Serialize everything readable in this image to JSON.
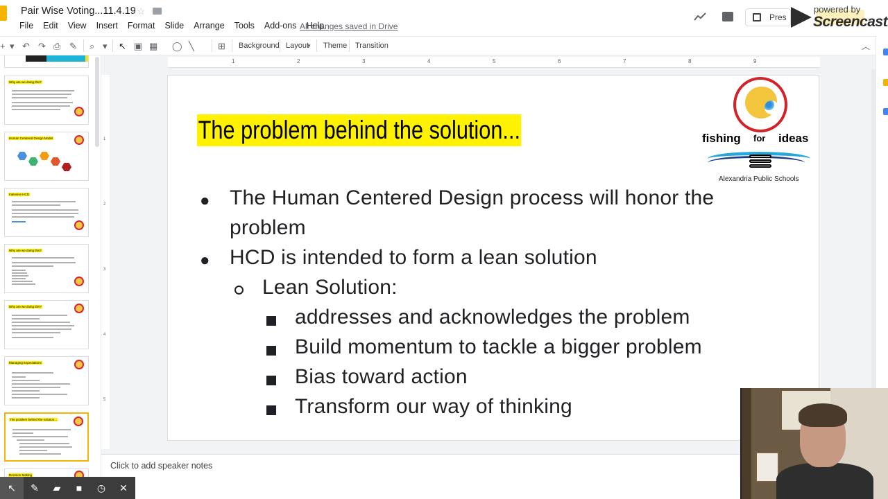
{
  "document": {
    "title": "Pair Wise Voting...11.4.19",
    "save_status": "All changes saved in Drive"
  },
  "menu": [
    "File",
    "Edit",
    "View",
    "Insert",
    "Format",
    "Slide",
    "Arrange",
    "Tools",
    "Add-ons",
    "Help"
  ],
  "header": {
    "present_label": "Pres",
    "screencast_powered": "powered by",
    "screencast_brand": "Screencastify"
  },
  "toolbar": {
    "background_label": "Background",
    "layout_label": "Layout",
    "theme_label": "Theme",
    "transition_label": "Transition"
  },
  "ruler": {
    "top_ticks": [
      "1",
      "2",
      "3",
      "4",
      "5",
      "6",
      "7",
      "8",
      "9"
    ],
    "left_ticks": [
      "1",
      "2",
      "3",
      "4",
      "5"
    ]
  },
  "filmstrip": {
    "thumbnails": [
      {
        "title": "",
        "kind": "image"
      },
      {
        "title": "Why are we doing this?",
        "kind": "text"
      },
      {
        "title": "Human Centered Design Model",
        "kind": "hexes"
      },
      {
        "title": "Intensive HCD",
        "kind": "text"
      },
      {
        "title": "Why are we doing this?",
        "kind": "text"
      },
      {
        "title": "Why are we doing this?",
        "kind": "text"
      },
      {
        "title": "Managing Expectations",
        "kind": "text"
      },
      {
        "title": "The problem behind the solution...",
        "kind": "text",
        "selected": true
      },
      {
        "title": "Decision Making",
        "kind": "text"
      }
    ]
  },
  "slide": {
    "title": "The problem behind the solution...",
    "bullets": [
      {
        "level": 1,
        "text": "The Human Centered Design process will honor the"
      },
      {
        "level": 1,
        "text": "problem",
        "continuation": true
      },
      {
        "level": 1,
        "text": "HCD is intended to form a lean solution"
      },
      {
        "level": 2,
        "text": "Lean Solution:"
      },
      {
        "level": 3,
        "text": "addresses and acknowledges the problem"
      },
      {
        "level": 3,
        "text": "Build momentum to tackle a bigger problem"
      },
      {
        "level": 3,
        "text": "Bias toward action"
      },
      {
        "level": 3,
        "text": "Transform our way of thinking"
      }
    ],
    "logo": {
      "left_word": "fishing",
      "middle_word": "for",
      "right_word": "ideas",
      "organization": "Alexandria Public Schools"
    }
  },
  "notes": {
    "placeholder": "Click to add speaker notes"
  },
  "colors": {
    "title_highlight": "#fff200",
    "selected_thumb_border": "#f4b400",
    "logo_red": "#d2232a",
    "logo_blue": "#29a6d9"
  },
  "icons": {
    "rec_controls": [
      "cursor-icon",
      "pen-icon",
      "highlighter-icon",
      "camera-icon",
      "timer-icon",
      "close-icon"
    ]
  }
}
